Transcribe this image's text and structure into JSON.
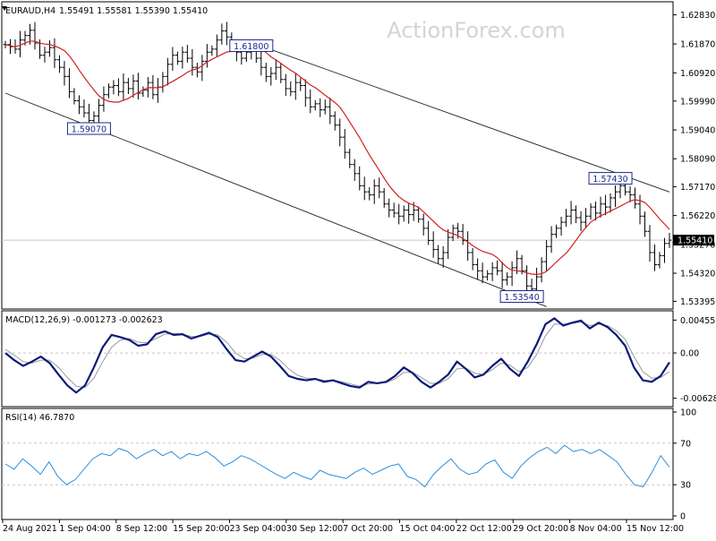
{
  "header": {
    "symbol": "EURAUD,H4",
    "ohlc": "1.55491 1.55581 1.55390 1.55410"
  },
  "watermark": "ActionForex.com",
  "colors": {
    "candle": "#000000",
    "sma": "#d22020",
    "macd": "#0b1a78",
    "signal": "#9a9a9a",
    "rsi": "#2a8fe0",
    "grid": "#c8c8c8",
    "channel": "#222222"
  },
  "chart_data": [
    {
      "type": "candlestick",
      "pane": "price",
      "ylim": [
        1.532,
        1.632
      ],
      "y_ticks": [
        "1.62830",
        "1.61870",
        "1.60920",
        "1.59990",
        "1.59040",
        "1.58090",
        "1.57170",
        "1.56220",
        "1.55270",
        "1.54320",
        "1.53395"
      ],
      "current_price": "1.55410",
      "annotations": [
        {
          "text": "1.61800",
          "x": 50,
          "y": 1.618
        },
        {
          "text": "1.59070",
          "x": 17,
          "y": 1.5907
        },
        {
          "text": "1.57430",
          "x": 123,
          "y": 1.5743
        },
        {
          "text": "1.53540",
          "x": 105,
          "y": 1.5354
        }
      ],
      "channel": {
        "upper": [
          [
            52,
            1.618
          ],
          [
            128,
            1.574
          ]
        ],
        "lower": [
          [
            0,
            1.6025
          ],
          [
            105,
            1.5354
          ]
        ]
      },
      "close": [
        1.6185,
        1.6178,
        1.617,
        1.62,
        1.6215,
        1.6232,
        1.619,
        1.615,
        1.616,
        1.6175,
        1.6135,
        1.611,
        1.608,
        1.603,
        1.6,
        1.598,
        1.596,
        1.5935,
        1.595,
        1.5985,
        1.602,
        1.6045,
        1.605,
        1.603,
        1.606,
        1.604,
        1.6065,
        1.6025,
        1.6035,
        1.606,
        1.602,
        1.6045,
        1.608,
        1.612,
        1.615,
        1.613,
        1.616,
        1.614,
        1.611,
        1.6095,
        1.613,
        1.616,
        1.617,
        1.62,
        1.623,
        1.621,
        1.618,
        1.616,
        1.614,
        1.616,
        1.6175,
        1.614,
        1.611,
        1.608,
        1.609,
        1.611,
        1.607,
        1.604,
        1.603,
        1.606,
        1.605,
        1.601,
        1.598,
        1.599,
        1.597,
        1.598,
        1.595,
        1.592,
        1.588,
        1.583,
        1.579,
        1.576,
        1.572,
        1.57,
        1.569,
        1.572,
        1.57,
        1.566,
        1.564,
        1.563,
        1.562,
        1.564,
        1.5625,
        1.564,
        1.561,
        1.558,
        1.554,
        1.551,
        1.548,
        1.55,
        1.555,
        1.558,
        1.557,
        1.554,
        1.55,
        1.546,
        1.544,
        1.542,
        1.543,
        1.545,
        1.544,
        1.541,
        1.542,
        1.545,
        1.548,
        1.544,
        1.539,
        1.538,
        1.542,
        1.547,
        1.552,
        1.556,
        1.558,
        1.56,
        1.562,
        1.564,
        1.5615,
        1.56,
        1.562,
        1.565,
        1.563,
        1.566,
        1.565,
        1.568,
        1.57,
        1.572,
        1.57,
        1.569,
        1.566,
        1.562,
        1.557,
        1.55,
        1.546,
        1.549,
        1.553,
        1.5541
      ]
    },
    {
      "type": "line",
      "pane": "macd",
      "label": "MACD(12,26,9) -0.001273 -0.002623",
      "ylim": [
        -0.0072,
        0.0056
      ],
      "y_ticks": [
        "0.004559",
        "0.00",
        "-0.006289"
      ],
      "series": [
        {
          "name": "MACD",
          "values": [
            0.0,
            -0.001,
            -0.0018,
            -0.0012,
            -0.0005,
            -0.0014,
            -0.003,
            -0.0045,
            -0.0055,
            -0.0045,
            -0.002,
            0.0008,
            0.0025,
            0.0022,
            0.0018,
            0.001,
            0.0012,
            0.0026,
            0.003,
            0.0025,
            0.0026,
            0.002,
            0.0024,
            0.0028,
            0.0022,
            0.0005,
            -0.001,
            -0.0012,
            -0.0005,
            0.0002,
            -0.0005,
            -0.0018,
            -0.0032,
            -0.0036,
            -0.0038,
            -0.0036,
            -0.004,
            -0.0038,
            -0.0042,
            -0.0046,
            -0.0048,
            -0.004,
            -0.0042,
            -0.004,
            -0.0032,
            -0.002,
            -0.0028,
            -0.004,
            -0.0048,
            -0.004,
            -0.003,
            -0.0012,
            -0.0022,
            -0.0034,
            -0.003,
            -0.0018,
            -0.0008,
            -0.0022,
            -0.0032,
            -0.0012,
            0.0012,
            0.004,
            0.0048,
            0.0038,
            0.0042,
            0.0045,
            0.0034,
            0.0042,
            0.0036,
            0.0025,
            0.001,
            -0.002,
            -0.0038,
            -0.004,
            -0.0032,
            -0.0013
          ]
        },
        {
          "name": "Signal",
          "values": [
            0.0005,
            -0.0003,
            -0.0012,
            -0.0014,
            -0.001,
            -0.001,
            -0.002,
            -0.0034,
            -0.0046,
            -0.0048,
            -0.0035,
            -0.0012,
            0.0008,
            0.0018,
            0.002,
            0.0015,
            0.0014,
            0.002,
            0.0026,
            0.0027,
            0.0026,
            0.0023,
            0.0023,
            0.0026,
            0.0025,
            0.0015,
            0.0,
            -0.0008,
            -0.0007,
            -0.0002,
            -0.0002,
            -0.001,
            -0.0022,
            -0.0031,
            -0.0035,
            -0.0036,
            -0.0038,
            -0.0038,
            -0.004,
            -0.0043,
            -0.0046,
            -0.0043,
            -0.0042,
            -0.0041,
            -0.0036,
            -0.0027,
            -0.0027,
            -0.0034,
            -0.0042,
            -0.0042,
            -0.0036,
            -0.0022,
            -0.0021,
            -0.0028,
            -0.003,
            -0.0023,
            -0.0014,
            -0.0017,
            -0.0026,
            -0.002,
            -0.0002,
            0.0024,
            0.004,
            0.004,
            0.0041,
            0.0043,
            0.0038,
            0.004,
            0.0038,
            0.0031,
            0.0019,
            -0.0005,
            -0.0026,
            -0.0035,
            -0.0034,
            -0.0026
          ]
        }
      ]
    },
    {
      "type": "line",
      "pane": "rsi",
      "label": "RSI(14) 46.7870",
      "ylim": [
        0,
        100
      ],
      "y_ticks": [
        "100",
        "70",
        "30",
        "0"
      ],
      "levels": [
        70,
        30
      ],
      "series": [
        {
          "name": "RSI",
          "values": [
            50,
            45,
            55,
            48,
            40,
            52,
            38,
            30,
            35,
            45,
            55,
            60,
            58,
            65,
            62,
            55,
            60,
            64,
            58,
            62,
            55,
            60,
            58,
            62,
            56,
            48,
            52,
            58,
            55,
            50,
            45,
            40,
            36,
            42,
            38,
            35,
            44,
            40,
            38,
            36,
            42,
            46,
            40,
            44,
            48,
            50,
            38,
            35,
            28,
            40,
            48,
            55,
            45,
            40,
            42,
            50,
            54,
            42,
            36,
            48,
            56,
            62,
            66,
            60,
            68,
            62,
            64,
            60,
            64,
            58,
            52,
            40,
            30,
            28,
            42,
            58,
            47
          ]
        }
      ]
    }
  ],
  "x_axis": {
    "labels": [
      "24 Aug 2021",
      "1 Sep 04:00",
      "8 Sep 12:00",
      "15 Sep 20:00",
      "23 Sep 04:00",
      "30 Sep 12:00",
      "7 Oct 20:00",
      "15 Oct 04:00",
      "22 Oct 12:00",
      "29 Oct 20:00",
      "8 Nov 04:00",
      "15 Nov 12:00"
    ]
  }
}
